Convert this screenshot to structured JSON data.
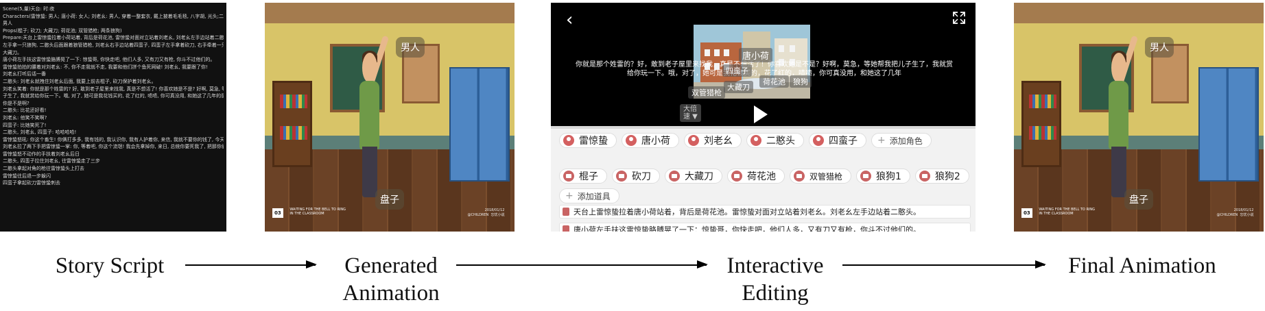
{
  "script": {
    "lines": [
      "Scene(5,量)天台: 时:夜",
      "Characters(雷惊蛰: 男人; 唐小荷: 女人; 刘老幺: 男人, 穿着一整套衣, 戴上披着毛毛毯, 八字胡, 光头;二憨头: 男人); 四蛮子:",
      "男人",
      "Props(棍子; 砍刀; 大藏刀; 荷花池; 双管猎枪; 两条狼狗)",
      "Prepare:天台上雷惊蛰拉着小荷站着, 背后是荷花池, 雷惊蛰对面对立站着刘老幺, 刘老幺左手边站着二憨头, 二憨头右手拿着棍子,",
      "左手拿一只狼狗, 二憨头后面跟着狼管猎枪, 刘老幺右手边站着四蛮子, 四蛮子左手拿着砍刀, 右手牵着一只狼狗, 四蛮子口袋里面藏着一把",
      "大藏刀。",
      "唐小荷左手扶这雷惊蛰胳膊晃了一下: 惊蛰哥, 你快走吧, 他们人多, 又有刀又有枪, 你斗不过他们的。",
      "雷惊蛰拍拍的腰着对刘老幺: 不, 你不走我就不走, 我要和他们拼个鱼死网破! 刘老幺, 我要跟了你!",
      "刘老幺打听后话一番",
      "二憨头: 刘老幺就拽住刘老幺后面, 我要上前去棍子, 砍刀保护着刘老幺。",
      "刘老幺笑着: 你就是那个姓雷的? 好, 敢到老子屋里来找我, 真是不想活了! 你喜欢她是不是? 好啊, 莫急, 等她帮我把儿",
      "子生了, 我就赏给你玩一下。哦, 对了, 她可是我花钱买的, 花了红的, 啧啧, 你可真没用, 和她这了几年的感情都不值个钱! 大家说",
      "你是不是啊?",
      "二憨头: 比花还好看!",
      "刘老幺: 他笑不笑啊?",
      "四蛮子: 比她笑死了!",
      "二憨头, 刘老幺, 四蛮子: 哈哈哈哈!",
      "雷惊蛰怒吼: 你这个畜生! 你俩打多多, 我有钱的, 我认识你, 我有人护着你, 来信, 我就不要你的钱了, 今天我要你和死!",
      "刘老幺拉了两下手把雷惊蛰一掌: 你, 等着吧, 你这个流氓! 我会先拿掉你, 来日, 总统你要死我了, 把那你们! 把东西摆啊!",
      "雷惊蛰怒不动作的手扶着刘老幺后日",
      "二憨头, 四蛮子拉住刘老幺, 往雷惊蛰走了三步",
      "二憨头拿起对角的枪往雷惊蛰头上打去",
      "雷惊蛰往后退一步躲闪",
      "四蛮子拿起砍刀雷惊蛰刺去"
    ]
  },
  "scene": {
    "tag_man": "男人",
    "tag_plate": "盘子",
    "logo_num": "03",
    "logo_caption": "WAITING FOR THE BELL TO RING\nIN THE CLASSROOM",
    "corner_caption": "2018/01/12\n@CHILDREN  忘忧小说"
  },
  "editing": {
    "back_icon": "‹",
    "subtitle": "你就是那个姓雷的？好，敢到老子屋里来找我，真是不想活了！你喜欢她是不是？好啊，莫急，等她帮我把儿子生了，我就赏给你玩一下。哦，对了，她可是我花钱买的，花了红的，啧啧，你可真没用，和她这了几年",
    "hotspots": {
      "tang": "唐小荷",
      "sister": "四蛮子",
      "knife": "大藏刀",
      "pond": "荷花池",
      "gun": "双管猎枪",
      "dog": "狼狗"
    },
    "speed_label": "大倍\n速 ▼",
    "roles": [
      "雷惊蛰",
      "唐小荷",
      "刘老幺",
      "二憨头",
      "四蛮子"
    ],
    "add_role": "添加角色",
    "props": [
      "棍子",
      "砍刀",
      "大藏刀",
      "荷花池",
      "双管猎枪",
      "狼狗1",
      "狼狗2"
    ],
    "add_prop": "添加道具",
    "lines": [
      "天台上雷惊蛰拉着唐小荷站着，背后是荷花池。雷惊蛰对面对立站着刘老幺。刘老幺左手边站着二憨头。",
      "唐小荷左手扶这雷惊蛰胳膊晃了一下：惊蛰哥，你快走吧，他们人多，又有刀又有枪，你斗不过他们的。"
    ]
  },
  "flow": {
    "step1": "Story Script",
    "step2_line1": "Generated",
    "step2_line2": "Animation",
    "step3_line1": "Interactive",
    "step3_line2": "Editing",
    "step4": "Final Animation"
  }
}
